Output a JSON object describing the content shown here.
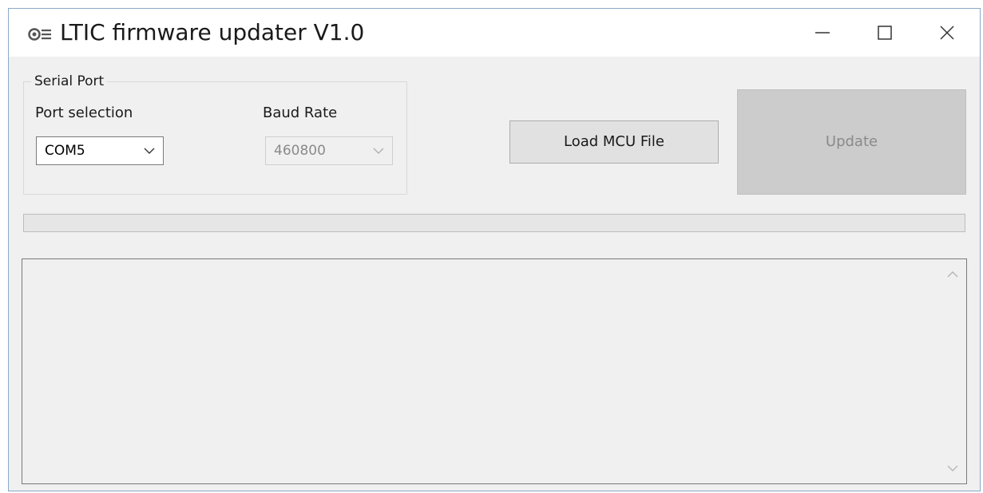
{
  "window": {
    "title": "LTIC firmware updater V1.0",
    "icons": [
      "app-icon",
      "minimize-icon",
      "maximize-icon",
      "close-icon"
    ]
  },
  "serial_port": {
    "group_label": "Serial Port",
    "port_label": "Port selection",
    "port_value": "COM5",
    "baud_label": "Baud Rate",
    "baud_value": "460800",
    "baud_enabled": false
  },
  "actions": {
    "load_label": "Load MCU File",
    "update_label": "Update",
    "update_enabled": false
  },
  "progress": {
    "value": 0
  },
  "log": {
    "text": ""
  },
  "colors": {
    "window_bg": "#f0f0f0",
    "titlebar_bg": "#ffffff",
    "disabled_text": "#8a8a8a",
    "update_bg": "#cccccc"
  }
}
